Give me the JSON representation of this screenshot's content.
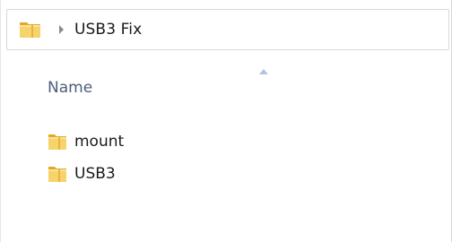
{
  "address_bar": {
    "breadcrumb": "USB3 Fix"
  },
  "column_header": {
    "name_label": "Name"
  },
  "files": [
    {
      "name": "mount",
      "icon": "folder-icon"
    },
    {
      "name": "USB3",
      "icon": "folder-icon"
    }
  ],
  "colors": {
    "folder_yellow": "#f3c94b",
    "header_text": "#4b607a"
  }
}
